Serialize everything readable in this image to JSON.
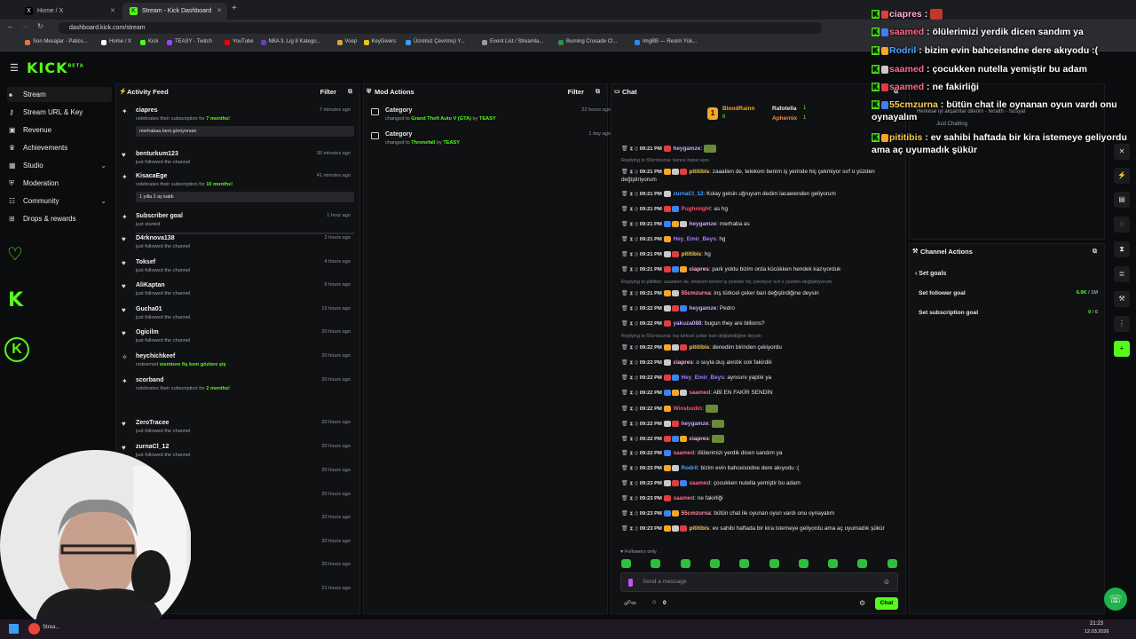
{
  "browser": {
    "tabs": [
      {
        "label": "Home / X",
        "active": false
      },
      {
        "label": "Stream - Kick Dashboard",
        "active": true
      }
    ],
    "url": "dashboard.kick.com/stream",
    "bookmarks": [
      "Son Mesajlar - Patics...",
      "Home / X",
      "Kick",
      "TEASY - Twitch",
      "YouTube",
      "NBA 3. Lig 8 Katego...",
      "Voep",
      "KeyGivers",
      "Ücretsiz Çevrimiçi Y...",
      "Event List / Streamla...",
      "Burning Crusade Cl...",
      "ImgBB — Resim Yük..."
    ]
  },
  "app": {
    "logo": "KICK",
    "logo_tag": "BETA",
    "sidebar": [
      {
        "label": "Stream",
        "icon": "stream-icon",
        "active": true
      },
      {
        "label": "Stream URL & Key",
        "icon": "key-icon"
      },
      {
        "label": "Revenue",
        "icon": "revenue-icon"
      },
      {
        "label": "Achievements",
        "icon": "trophy-icon"
      },
      {
        "label": "Studio",
        "icon": "studio-icon",
        "expandable": true
      },
      {
        "label": "Moderation",
        "icon": "shield-icon"
      },
      {
        "label": "Community",
        "icon": "community-icon",
        "expandable": true
      },
      {
        "label": "Drops & rewards",
        "icon": "gift-icon"
      }
    ]
  },
  "activity_feed": {
    "title": "Activity Feed",
    "filter": "Filter",
    "items": [
      {
        "name": "ciapres",
        "desc_pre": "celebrates their subscription for ",
        "desc_hl": "7 months!",
        "time": "7 minutes ago",
        "msg": "merhabaa beni görüyorsan"
      },
      {
        "name": "benturkum123",
        "desc": "just followed the channel",
        "time": "36 minutes ago"
      },
      {
        "name": "KisacaEge",
        "desc_pre": "celebrates their subscription for ",
        "desc_hl": "10 months!",
        "time": "41 minutes ago",
        "msg": "1 yılla 2 ay kaldı"
      },
      {
        "name": "Subscriber goal",
        "desc": "just started",
        "time": "1 hour ago"
      },
      {
        "name": "D4rknova138",
        "desc": "just followed the channel",
        "time": "2 hours ago"
      },
      {
        "name": "Toksef",
        "desc": "just followed the channel",
        "time": "4 hours ago"
      },
      {
        "name": "AliKaptan",
        "desc": "just followed the channel",
        "time": "6 hours ago"
      },
      {
        "name": "Gucha01",
        "desc": "just followed the channel",
        "time": "15 hours ago"
      },
      {
        "name": "Ogicilm",
        "desc": "just followed the channel",
        "time": "20 hours ago"
      },
      {
        "name": "heychichkeef",
        "desc_pre": "redeemed ",
        "desc_hl": "oiemtore fiş kem gözlere şiş",
        "time": "20 hours ago"
      },
      {
        "name": "scorband",
        "desc_pre": "celebrates their subscription for ",
        "desc_hl": "2 months!",
        "time": "20 hours ago"
      },
      {
        "name": "ZeroTracee",
        "desc": "just followed the channel",
        "time": "20 hours ago"
      },
      {
        "name": "zurnaCl_12",
        "desc": "just followed the channel",
        "time": "20 hours ago"
      }
    ],
    "extra_times": [
      "20 hours ago",
      "20 hours ago",
      "20 hours ago",
      "20 hours ago",
      "20 hours ago",
      "21 hours ago"
    ]
  },
  "mod_actions": {
    "title": "Mod Actions",
    "filter": "Filter",
    "items": [
      {
        "name": "Category",
        "pre": "changed to ",
        "hl": "Grand Theft Auto V (GTA)",
        "mid": " by ",
        "by": "TEASY",
        "time": "22 hours ago"
      },
      {
        "name": "Category",
        "pre": "changed to ",
        "hl": "Thronefall",
        "mid": " by ",
        "by": "TEASY",
        "time": "1 day ago"
      }
    ]
  },
  "chat": {
    "title": "Chat",
    "leaderboard": [
      {
        "name": "BloodRainn",
        "count": "6"
      },
      {
        "name": "Rafotella",
        "count": "1"
      },
      {
        "name": "Aphernix",
        "count": "1"
      }
    ],
    "messages": [
      {
        "time": "09:21 PM",
        "user": "heygamze",
        "color": "#c9a7ff",
        "text": ""
      },
      {
        "reply": "Replying to 55cmzurna: bence hepsi aynı"
      },
      {
        "time": "09:21 PM",
        "user": "pititibis",
        "color": "#f7c948",
        "text": "zaaatien de, telekom benim iş yerinde hiç çekmiyor sırf o yüzden değiştiriyorum"
      },
      {
        "time": "09:21 PM",
        "user": "zurnaCl_12",
        "color": "#4aa3ff",
        "text": "Kolay gelsin uğruyum dedim lacawenden geliyorum"
      },
      {
        "time": "09:21 PM",
        "user": "Pughmight",
        "color": "#ff4d6d",
        "text": "as hg"
      },
      {
        "time": "09:21 PM",
        "user": "heygamze",
        "color": "#c9a7ff",
        "text": "merhaba as"
      },
      {
        "time": "09:21 PM",
        "user": "Hey_Emir_Beys",
        "color": "#a67cff",
        "text": "hg"
      },
      {
        "time": "09:21 PM",
        "user": "pititibis",
        "color": "#f7c948",
        "text": "hg"
      },
      {
        "time": "09:21 PM",
        "user": "ciapres",
        "color": "#ffb3d9",
        "text": "park yoktu bizim orda kücükken hendek kazıyorduk"
      },
      {
        "reply": "Replying to pititibis: zaaatien de, telekom benim iş yerinde hiç çekmiyor sırf o yüzden değiştiriyorum"
      },
      {
        "time": "09:21 PM",
        "user": "55cmzurna",
        "color": "#ff8fa3",
        "text": "inş türkcel çeker bari değiştirdiğine deysin"
      },
      {
        "time": "09:22 PM",
        "user": "heygamze",
        "color": "#c9a7ff",
        "text": "Pedro"
      },
      {
        "time": "09:22 PM",
        "user": "yakuza088",
        "color": "#c9a7ff",
        "text": "bugun they are billions?"
      },
      {
        "reply": "Replying to 55cmzurna: inş türkcel çeker bari değiştirdiğine deysin"
      },
      {
        "time": "09:22 PM",
        "user": "pititibis",
        "color": "#f7c948",
        "text": "denedim birinden çekiyordu"
      },
      {
        "time": "09:22 PM",
        "user": "ciapres",
        "color": "#ffb3d9",
        "text": "o suyla duş alırdık cok fakirdik"
      },
      {
        "time": "09:22 PM",
        "user": "Hey_Emir_Beys",
        "color": "#a67cff",
        "text": "aynısını yaptık ya"
      },
      {
        "time": "09:22 PM",
        "user": "saamed",
        "color": "#ff6b8a",
        "text": "ABİ EN FAKİR SENDİN"
      },
      {
        "time": "09:22 PM",
        "user": "Winsbodin",
        "color": "#ff4d6d",
        "text": ""
      },
      {
        "time": "09:22 PM",
        "user": "heygamze",
        "color": "#c9a7ff",
        "text": ""
      },
      {
        "time": "09:22 PM",
        "user": "ciapres",
        "color": "#ffb3d9",
        "text": ""
      },
      {
        "time": "09:22 PM",
        "user": "saamed",
        "color": "#ff6b8a",
        "text": "ölülerimizi yerdik dicen sandım ya"
      },
      {
        "time": "09:23 PM",
        "user": "Rodril",
        "color": "#4aa3ff",
        "text": "bizim evin bahceisndne dere akıyodu :("
      },
      {
        "time": "09:23 PM",
        "user": "saamed",
        "color": "#ff6b8a",
        "text": "çocukken nutella yemiştir bu adam"
      },
      {
        "time": "09:23 PM",
        "user": "saamed",
        "color": "#ff6b8a",
        "text": "ne fakirliği"
      },
      {
        "time": "09:23 PM",
        "user": "55cmzurna",
        "color": "#ff8fa3",
        "text": "bütün chat ile oyunan oyun vardı onu oynayalım"
      },
      {
        "time": "09:23 PM",
        "user": "pititibis",
        "color": "#f7c948",
        "text": "ev sahibi haftada bir kira istemeye geliyordu ama aç uyumadık şükür"
      }
    ],
    "followers_only": "Followers only",
    "placeholder": "Send a message",
    "send_label": "Chat",
    "user_count": "0"
  },
  "channel_actions": {
    "title": "Channel Actions",
    "back_label": "Set goals",
    "goals": [
      {
        "label": "Set follower goal",
        "value_hl": "6.9K",
        "value": " / 1M"
      },
      {
        "label": "Set subscription goal",
        "value_hl": "0",
        "value": " / 6"
      }
    ]
  },
  "overlay_chat": [
    {
      "user": "ciapres",
      "color": "#ffb3d9",
      "text": ""
    },
    {
      "user": "saamed",
      "color": "#ff6b8a",
      "text": "ölülerimizi yerdik dicen sandım ya"
    },
    {
      "user": "Rodril",
      "color": "#4aa3ff",
      "text": "bizim evin bahceisndne dere akıyodu :("
    },
    {
      "user": "saamed",
      "color": "#ff6b8a",
      "text": "çocukken nutella yemiştir bu adam"
    },
    {
      "user": "saamed",
      "color": "#ff6b8a",
      "text": "ne fakirliği"
    },
    {
      "user": "55cmzurna",
      "color": "#ffd34d",
      "text": "bütün chat ile oynanan oyun vardı onu oynayalım"
    },
    {
      "user": "pititibis",
      "color": "#f7c948",
      "text": "ev sahibi haftada bir kira istemeye geliyordu ama aç uyumadık şükür"
    }
  ],
  "overlay_bg": [
    "Just Chatting",
    "Herkese iyi akşamlar dilerim - !wraith - !sosyal"
  ],
  "taskbar": {
    "time": "21:23",
    "date": "12.03.2026",
    "app": "Strea..."
  },
  "colors": {
    "accent": "#53fc18",
    "panel": "#101113",
    "bg": "#0b0c0d"
  }
}
